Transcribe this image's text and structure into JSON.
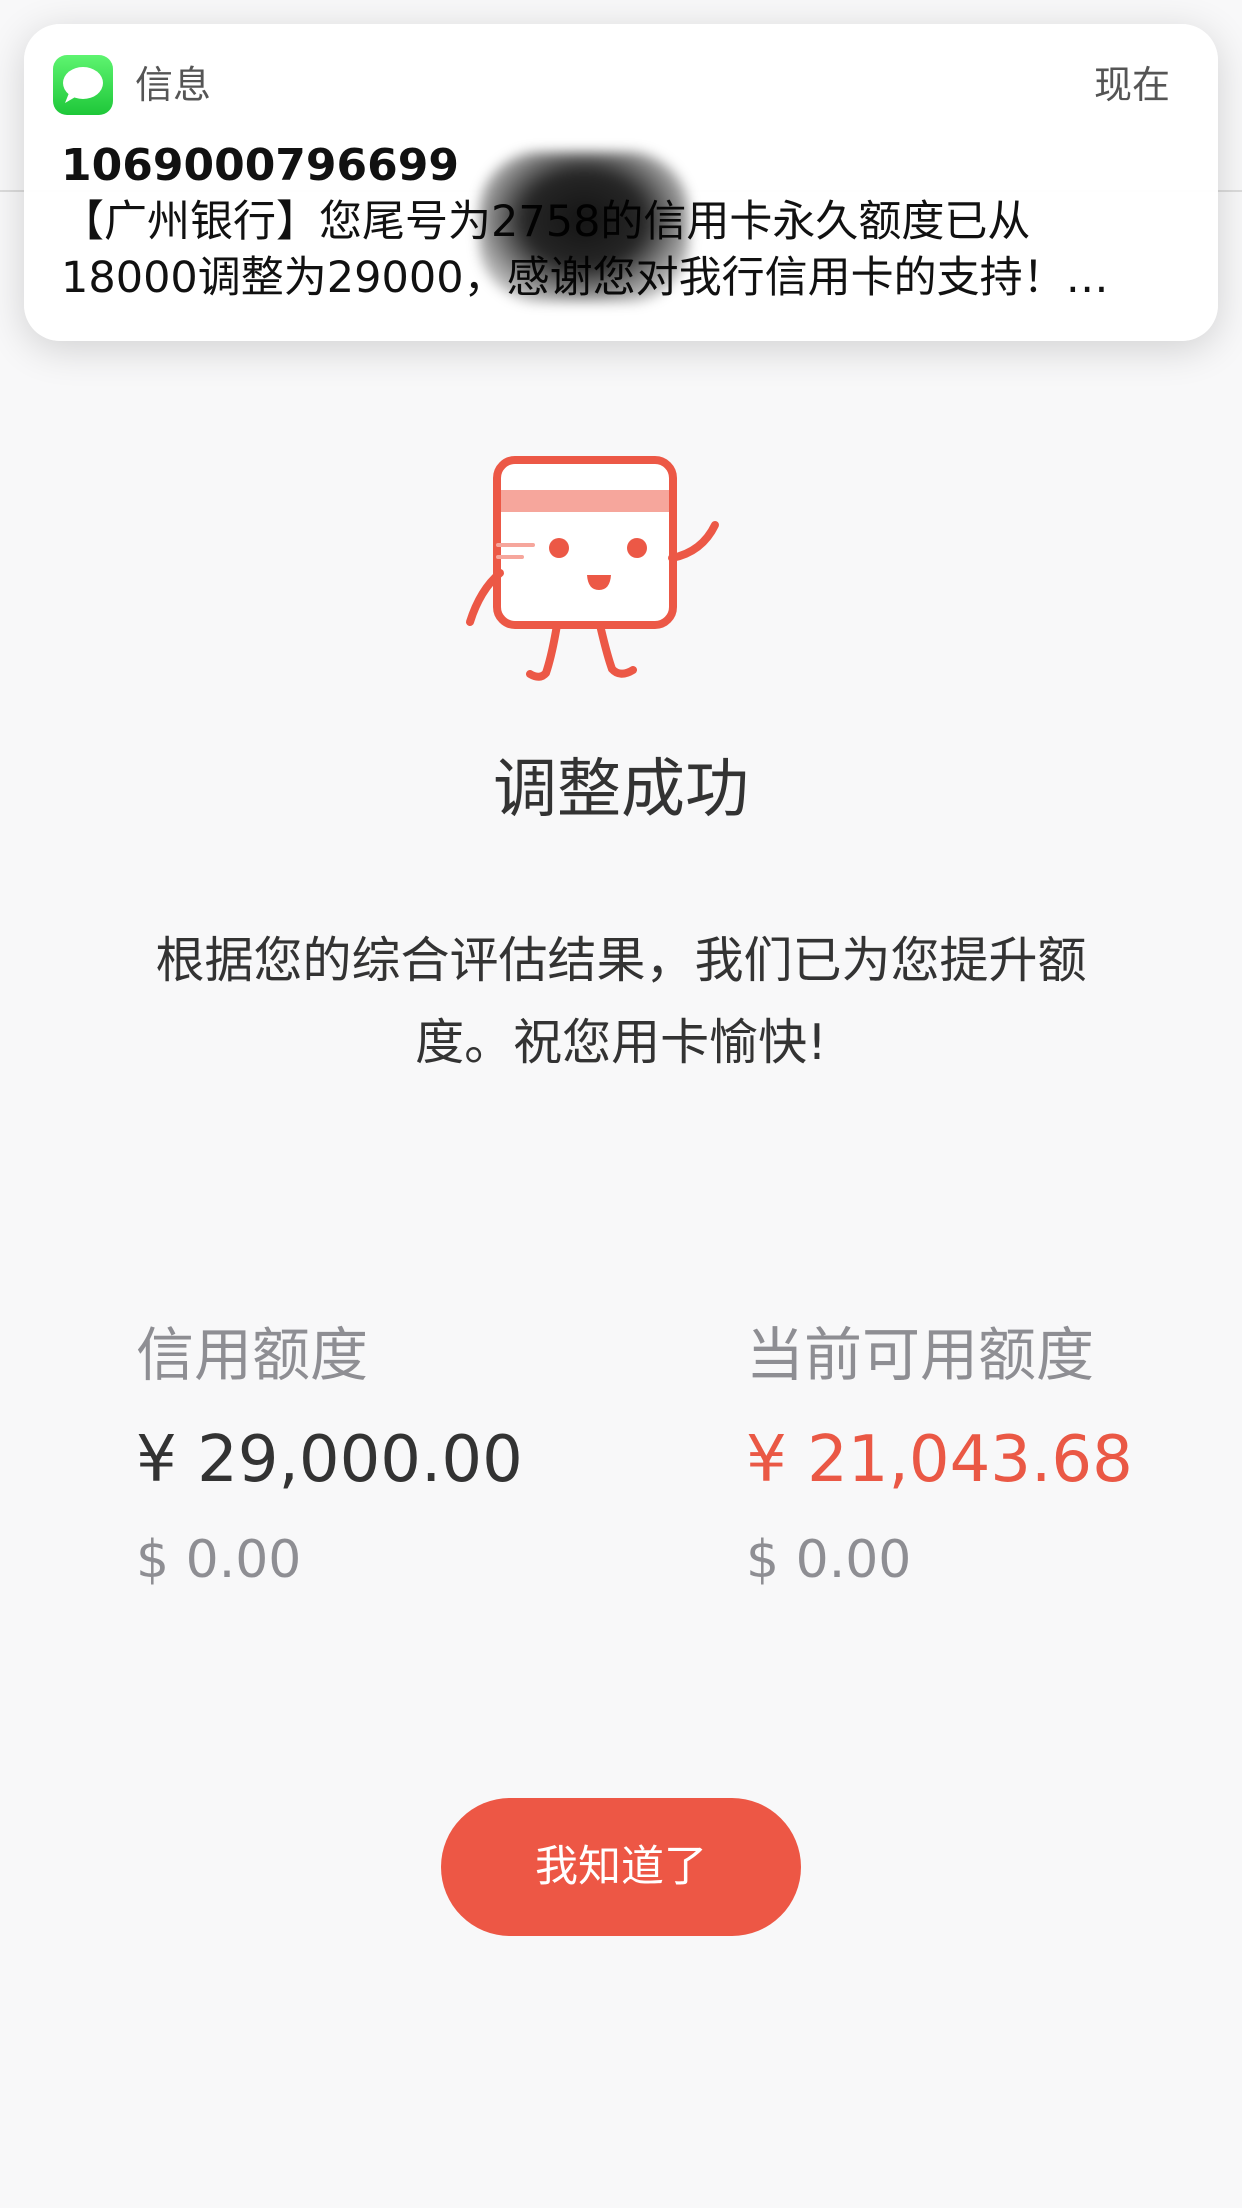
{
  "notification": {
    "app_name": "信息",
    "time": "现在",
    "sender": "1069000796699",
    "body": "【广州银行】您尾号为2758的信用卡永久额度已从\n18000调整为29000，感谢您对我行信用卡的支持！…",
    "icon": "messages-icon"
  },
  "result": {
    "mascot_icon": "credit-card-mascot-icon",
    "title": "调整成功",
    "message": "根据您的综合评估结果，我们已为您提升额度。祝您用卡愉快!"
  },
  "limits": {
    "credit_limit": {
      "label": "信用额度",
      "cny": "¥ 29,000.00",
      "usd": "$ 0.00"
    },
    "available_limit": {
      "label": "当前可用额度",
      "cny": "¥ 21,043.68",
      "usd": "$ 0.00"
    }
  },
  "actions": {
    "confirm_label": "我知道了"
  },
  "colors": {
    "accent": "#ed5745",
    "highlight_amount": "#ea5845",
    "messages_green": "#2fd14a"
  }
}
